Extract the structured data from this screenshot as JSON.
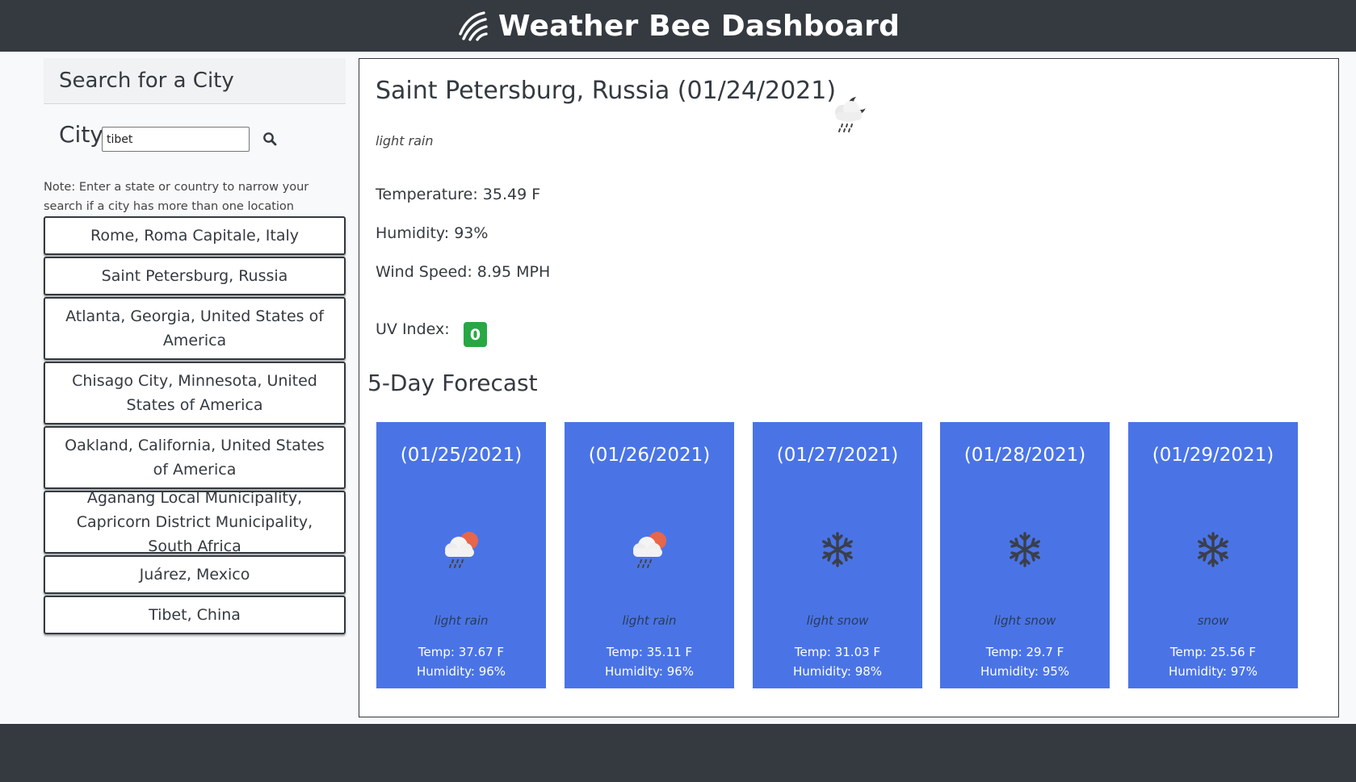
{
  "header": {
    "title": "Weather Bee Dashboard",
    "logo_icon": "striped-leaf-logo"
  },
  "search": {
    "heading": "Search for a City",
    "city_label": "City",
    "input_value": "tibet",
    "button_icon": "search-icon",
    "note": "Note: Enter a state or country to narrow your search if a city has more than one location"
  },
  "history": [
    {
      "label": "Rome, Roma Capitale, Italy"
    },
    {
      "label": "Saint Petersburg, Russia"
    },
    {
      "label": "Atlanta, Georgia, United States of America"
    },
    {
      "label": "Chisago City, Minnesota, United States of America"
    },
    {
      "label": "Oakland, California, United States of America"
    },
    {
      "label": "Aganang Local Municipality, Capricorn District Municipality, South Africa"
    },
    {
      "label": "Juárez, Mexico"
    },
    {
      "label": "Tibet, China"
    }
  ],
  "current": {
    "title": "Saint Petersburg, Russia (01/24/2021)",
    "icon": "rain-night-cloud-icon",
    "description": "light rain",
    "temperature": "Temperature: 35.49 F",
    "humidity": "Humidity: 93%",
    "wind": "Wind Speed: 8.95 MPH",
    "uv_label": "UV Index:",
    "uv_value": "0",
    "uv_color": "#28a745"
  },
  "forecast": {
    "title": "5-Day Forecast",
    "card_color": "#4a74e6",
    "days": [
      {
        "date": "(01/25/2021)",
        "icon": "rain-sun-cloud-icon",
        "description": "light rain",
        "temp": "Temp: 37.67 F",
        "humidity": "Humidity: 96%"
      },
      {
        "date": "(01/26/2021)",
        "icon": "rain-sun-cloud-icon",
        "description": "light rain",
        "temp": "Temp: 35.11 F",
        "humidity": "Humidity: 96%"
      },
      {
        "date": "(01/27/2021)",
        "icon": "snowflake-icon",
        "description": "light snow",
        "temp": "Temp: 31.03 F",
        "humidity": "Humidity: 98%"
      },
      {
        "date": "(01/28/2021)",
        "icon": "snowflake-icon",
        "description": "light snow",
        "temp": "Temp: 29.7 F",
        "humidity": "Humidity: 95%"
      },
      {
        "date": "(01/29/2021)",
        "icon": "snowflake-icon",
        "description": "snow",
        "temp": "Temp: 25.56 F",
        "humidity": "Humidity: 97%"
      }
    ]
  }
}
